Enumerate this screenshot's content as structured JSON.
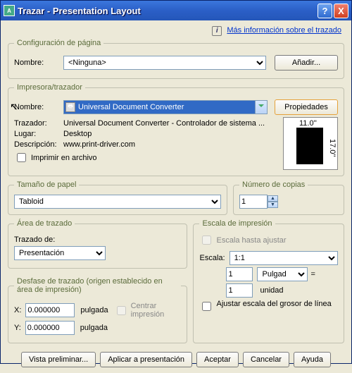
{
  "titlebar": {
    "title": "Trazar - Presentation Layout",
    "help": "?",
    "close": "X"
  },
  "top": {
    "info": "i",
    "link": "Más información sobre el trazado"
  },
  "pageConfig": {
    "legend": "Configuración de página",
    "name_label": "Nombre:",
    "name_value": "<Ninguna>",
    "add_btn": "Añadir..."
  },
  "printer": {
    "legend": "Impresora/trazador",
    "name_label": "Nombre:",
    "name_value": "Universal Document Converter",
    "props_btn": "Propiedades",
    "plotter_label": "Trazador:",
    "plotter_value": "Universal Document Converter - Controlador de sistema ...",
    "location_label": "Lugar:",
    "location_value": "Desktop",
    "desc_label": "Descripción:",
    "desc_value": "www.print-driver.com",
    "print_file": "Imprimir en archivo",
    "preview_w": "11.0''",
    "preview_h": "17.0''"
  },
  "paper": {
    "legend": "Tamaño de papel",
    "value": "Tabloid"
  },
  "copies": {
    "legend": "Número de copias",
    "value": "1"
  },
  "plotArea": {
    "legend": "Área de trazado",
    "label": "Trazado de:",
    "value": "Presentación"
  },
  "scale": {
    "legend": "Escala de impresión",
    "fit": "Escala hasta ajustar",
    "scale_label": "Escala:",
    "scale_value": "1:1",
    "num1": "1",
    "unit1": "Pulgadas",
    "eq": "=",
    "num2": "1",
    "unit2": "unidad",
    "lineweight": "Ajustar escala del grosor de línea"
  },
  "offset": {
    "legend": "Desfase de trazado (origen establecido en área de impresión)",
    "x_label": "X:",
    "x_value": "0.000000",
    "x_unit": "pulgada",
    "center": "Centrar impresión",
    "y_label": "Y:",
    "y_value": "0.000000",
    "y_unit": "pulgada"
  },
  "buttons": {
    "preview": "Vista preliminar...",
    "apply": "Aplicar a presentación",
    "ok": "Aceptar",
    "cancel": "Cancelar",
    "help": "Ayuda"
  }
}
